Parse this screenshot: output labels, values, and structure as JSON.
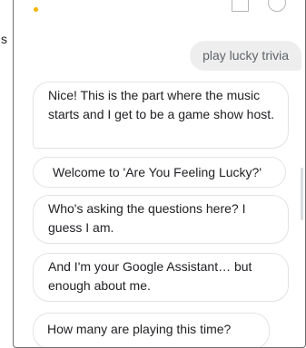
{
  "page_edge_text": "s",
  "conversation": {
    "user_message": "play lucky trivia",
    "assistant_messages": [
      "Nice! This is the part where the music starts and I get to be a game show host.",
      "Welcome to 'Are You Feeling Lucky?'",
      "Who's asking the questions here? I guess I am.",
      "And I'm your Google Assistant… but enough about me.",
      "How many are playing this time?"
    ]
  },
  "icons": {
    "status_dot": "status-dot-icon",
    "keyboard": "keyboard-icon",
    "explore": "explore-icon"
  },
  "colors": {
    "status_dot": "#f4b400",
    "user_bubble": "#eeeeee",
    "bubble_border": "#e3e3e3"
  }
}
